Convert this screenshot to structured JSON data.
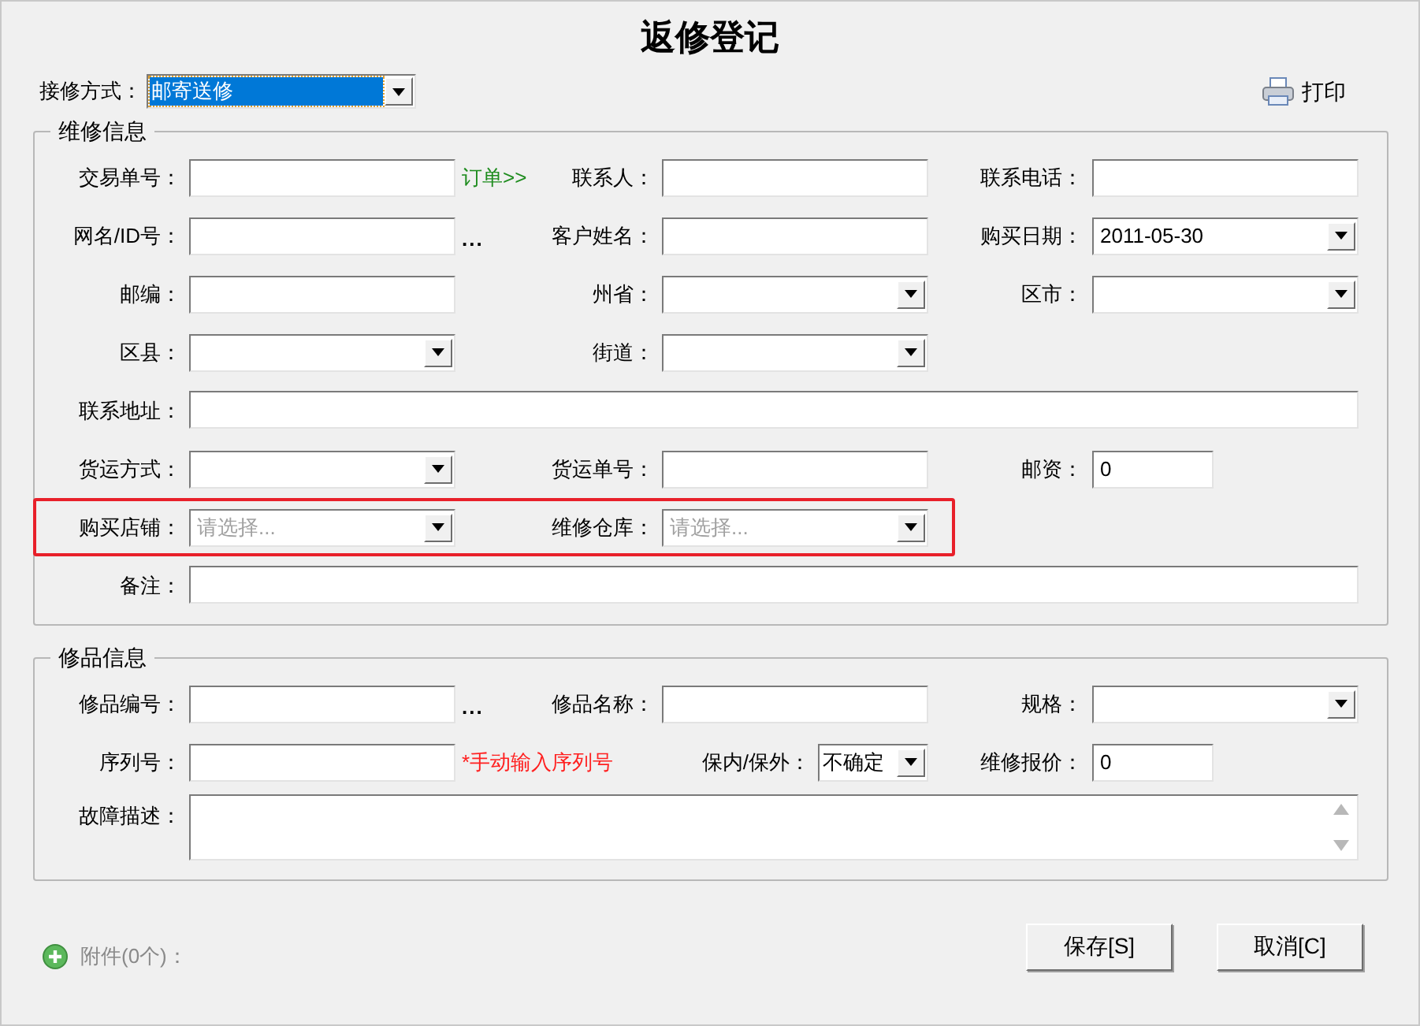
{
  "title": "返修登记",
  "method": {
    "label": "接修方式：",
    "value": "邮寄送修",
    "highlighted": true
  },
  "print_button": {
    "label": "打印"
  },
  "sections": [
    {
      "title": "维修信息",
      "rows": [
        {
          "highlighted": false,
          "fields": [
            {
              "label": "交易单号：",
              "kind": "text",
              "extra": {
                "kind": "link",
                "text": "订单>>"
              }
            },
            {
              "label": "联系人：",
              "kind": "text"
            },
            {
              "label": "联系电话：",
              "kind": "text"
            }
          ]
        },
        {
          "highlighted": false,
          "fields": [
            {
              "label": "网名/ID号：",
              "kind": "text",
              "extra": {
                "kind": "ellipsis",
                "text": "..."
              }
            },
            {
              "label": "客户姓名：",
              "kind": "text"
            },
            {
              "label": "购买日期：",
              "kind": "combo",
              "value": "2011-05-30"
            }
          ]
        },
        {
          "highlighted": false,
          "fields": [
            {
              "label": "邮编：",
              "kind": "text"
            },
            {
              "label": "州省：",
              "kind": "combo"
            },
            {
              "label": "区市：",
              "kind": "combo"
            }
          ]
        },
        {
          "highlighted": false,
          "fields": [
            {
              "label": "区县：",
              "kind": "combo"
            },
            {
              "label": "街道：",
              "kind": "combo"
            }
          ]
        },
        {
          "highlighted": false,
          "fields": [
            {
              "label": "联系地址：",
              "kind": "wide-text"
            }
          ]
        },
        {
          "highlighted": false,
          "fields": [
            {
              "label": "货运方式：",
              "kind": "combo"
            },
            {
              "label": "货运单号：",
              "kind": "text"
            },
            {
              "label": "邮资：",
              "kind": "short-text",
              "value": "0"
            }
          ]
        },
        {
          "highlighted": true,
          "fields": [
            {
              "label": "购买店铺：",
              "kind": "combo",
              "placeholder": "请选择..."
            },
            {
              "label": "维修仓库：",
              "kind": "combo",
              "placeholder": "请选择..."
            }
          ]
        },
        {
          "highlighted": false,
          "fields": [
            {
              "label": "备注：",
              "kind": "wide-text"
            }
          ]
        }
      ]
    },
    {
      "title": "修品信息",
      "rows": [
        {
          "highlighted": false,
          "fields": [
            {
              "label": "修品编号：",
              "kind": "text",
              "extra": {
                "kind": "ellipsis",
                "text": "..."
              }
            },
            {
              "label": "修品名称：",
              "kind": "text"
            },
            {
              "label": "规格：",
              "kind": "combo"
            }
          ]
        },
        {
          "highlighted": false,
          "fields": [
            {
              "label": "序列号：",
              "kind": "text",
              "extra": {
                "kind": "note",
                "text": "*手动输入序列号"
              }
            },
            {
              "label": "保内/保外：",
              "kind": "small-combo",
              "value": "不确定"
            },
            {
              "label": "维修报价：",
              "kind": "short-text",
              "value": "0"
            }
          ]
        },
        {
          "highlighted": false,
          "fields": [
            {
              "label": "故障描述：",
              "kind": "memo"
            }
          ]
        }
      ]
    }
  ],
  "attachments": {
    "label": "附件(0个)："
  },
  "buttons": [
    "保存[S]",
    "取消[C]"
  ]
}
